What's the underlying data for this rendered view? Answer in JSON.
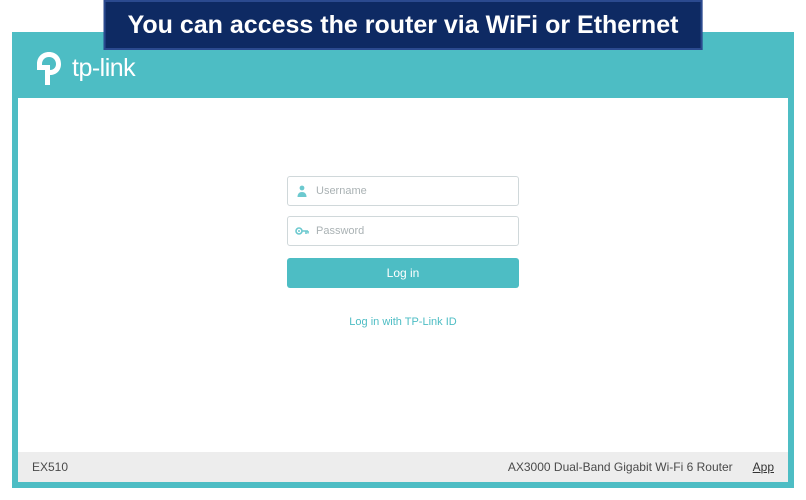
{
  "callout_text": "You can access the router via WiFi or Ethernet",
  "brand": "tp-link",
  "login": {
    "username_placeholder": "Username",
    "password_placeholder": "Password",
    "login_button": "Log in",
    "tplink_id_link": "Log in with TP-Link ID"
  },
  "footer": {
    "model": "EX510",
    "product": "AX3000 Dual-Band Gigabit Wi-Fi 6 Router",
    "app_link": "App"
  }
}
